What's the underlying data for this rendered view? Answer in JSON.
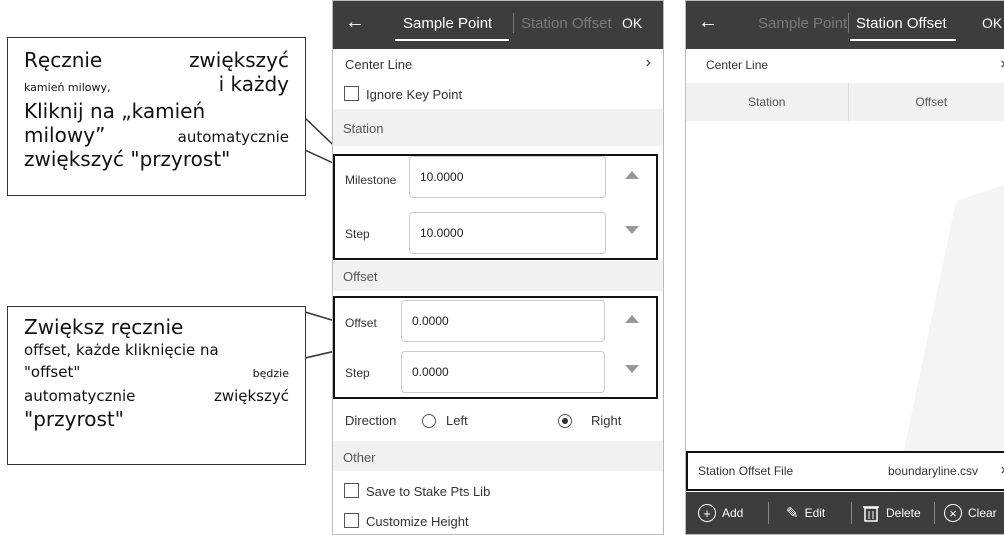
{
  "callout1": {
    "line1_a": "Ręcznie",
    "line1_b": "zwiększyć",
    "line2_a": "kamień milowy,",
    "line2_b": "i każdy",
    "line3": "Kliknij na „kamień",
    "line4_a": "milowy”",
    "line4_b": "automatycznie",
    "line5": "zwiększyć \"przyrost\""
  },
  "callout2": {
    "line1": "Zwiększ ręcznie",
    "line2": "offset, każde kliknięcie na",
    "line3_a": "\"offset\"",
    "line3_b": "będzie",
    "line4_a": "automatycznie",
    "line4_b": "zwiększyć",
    "line5": "\"przyrost\""
  },
  "left_screen": {
    "back_icon": "arrow-left-icon",
    "tabs": [
      "Sample Point",
      "Station Offset"
    ],
    "active_tab": 0,
    "ok_label": "OK",
    "center_line_label": "Center Line",
    "ignore_key_point_label": "Ignore Key Point",
    "station_section": "Station",
    "milestone_label": "Milestone",
    "milestone_value": "10.0000",
    "step_label": "Step",
    "step_value": "10.0000",
    "offset_section": "Offset",
    "offset_label": "Offset",
    "offset_value": "0.0000",
    "offset_step_label": "Step",
    "offset_step_value": "0.0000",
    "direction_label": "Direction",
    "left_label": "Left",
    "right_label": "Right",
    "direction_selected": "Right",
    "other_section": "Other",
    "save_label": "Save to Stake Pts Lib",
    "customize_label": "Customize Height"
  },
  "right_screen": {
    "back_icon": "arrow-left-icon",
    "tabs": [
      "Sample Point",
      "Station Offset"
    ],
    "active_tab": 1,
    "ok_label": "OK",
    "center_line_label": "Center Line",
    "col_station": "Station",
    "col_offset": "Offset",
    "file_label": "Station Offset File",
    "file_value": "boundaryline.csv",
    "add_label": "Add",
    "edit_label": "Edit",
    "delete_label": "Delete",
    "clear_label": "Clear"
  },
  "colors": {
    "topbar": "#3d3d3d",
    "section_bg": "#f1f1f1",
    "highlight_border": "#111111"
  }
}
